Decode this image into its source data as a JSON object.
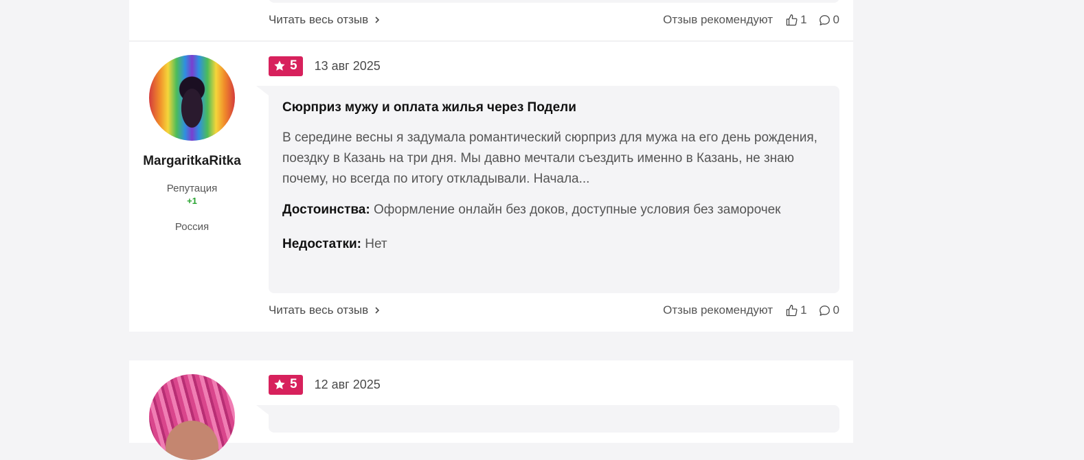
{
  "reviews": [
    {
      "footer": {
        "read_more": "Читать весь отзыв",
        "recommend_label": "Отзыв рекомендуют",
        "likes": "1",
        "comments": "0"
      }
    },
    {
      "author": {
        "name": "MargaritkaRitka",
        "reputation_label": "Репутация",
        "reputation_value": "+1",
        "location": "Россия"
      },
      "rating": "5",
      "date": "13 авг 2025",
      "title": "Сюрприз мужу и оплата жилья через Подели",
      "body": "В середине весны я задумала романтический сюрприз для мужа на его день рождения, поездку в Казань на три дня. Мы давно мечтали съездить именно в Казань, не знаю почему, но всегда по итогу откладывали. Начала...",
      "pros_label": "Достоинства:",
      "pros": "Оформление онлайн без доков, доступные условия без заморочек",
      "cons_label": "Недостатки:",
      "cons": "Нет",
      "footer": {
        "read_more": "Читать весь отзыв",
        "recommend_label": "Отзыв рекомендуют",
        "likes": "1",
        "comments": "0"
      }
    },
    {
      "rating": "5",
      "date": "12 авг 2025"
    }
  ],
  "colors": {
    "badge": "#d7215c",
    "reputation": "#2aa531",
    "bubble": "#f4f4f6"
  },
  "icons": {
    "star": "star-icon",
    "like": "thumbs-up-icon",
    "comment": "comment-icon",
    "chevron": "chevron-right-icon"
  }
}
